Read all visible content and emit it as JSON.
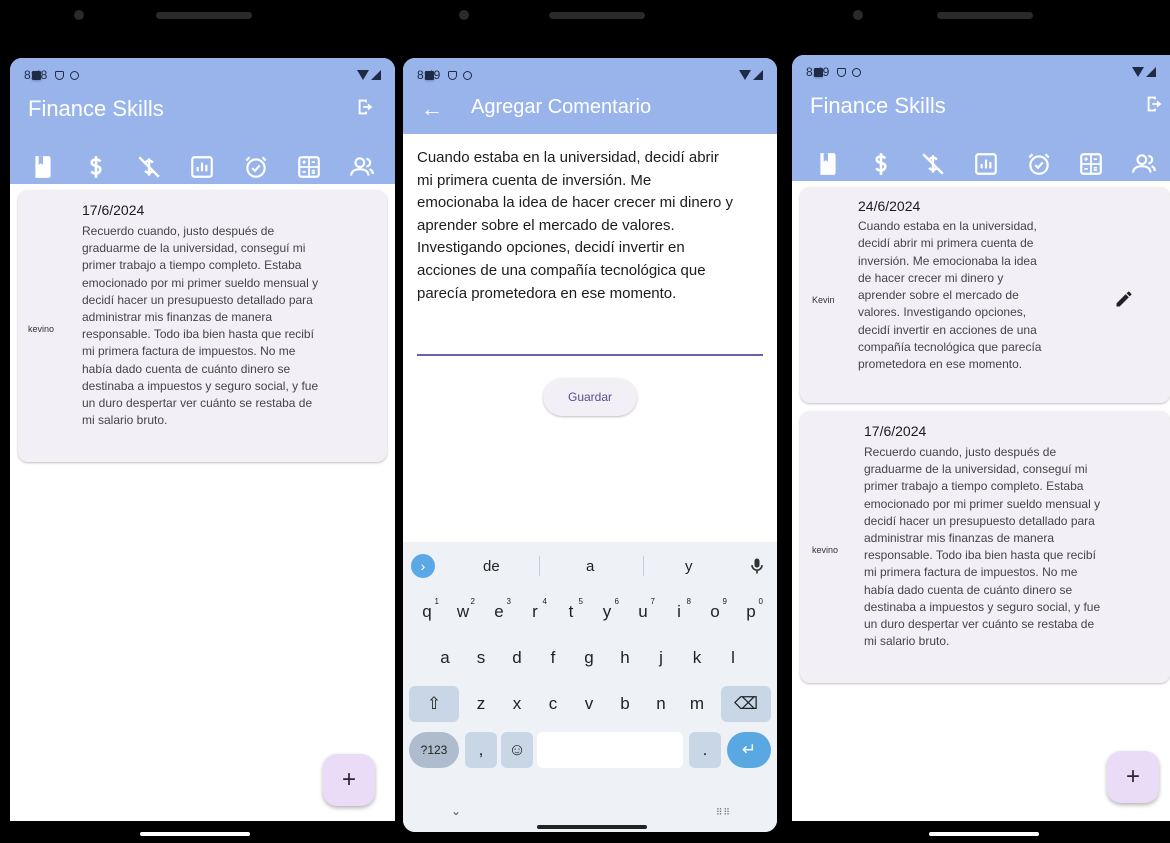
{
  "phone1": {
    "time": "8:48",
    "title": "Finance Skills",
    "comments": [
      {
        "author": "kevino",
        "date": "17/6/2024",
        "lines": [
          "Recuerdo cuando, justo después de",
          "graduarme de la universidad, conseguí mi",
          "primer trabajo a tiempo completo. Estaba",
          "emocionado por mi primer sueldo mensual y",
          "decidí hacer un presupuesto detallado para",
          "administrar mis finanzas de manera",
          "responsable. Todo iba bien hasta que recibí",
          "mi primera factura de impuestos. No me",
          "había dado cuenta de cuánto dinero se",
          "destinaba a impuestos y seguro social, y fue",
          "un duro despertar ver cuánto se restaba de",
          "mi salario bruto."
        ]
      }
    ],
    "fab_label": "+"
  },
  "phone2": {
    "time": "8:49",
    "title": "Agregar Comentario",
    "back_label": "←",
    "comment_lines": [
      "Cuando estaba en la universidad, decidí abrir",
      "mi primera cuenta de inversión. Me",
      "emocionaba la idea de hacer crecer mi dinero y",
      "aprender sobre el mercado de valores.",
      "Investigando opciones, decidí invertir en",
      "acciones de una compañía tecnológica que",
      "parecía prometedora en ese momento."
    ],
    "save_label": "Guardar",
    "keyboard": {
      "suggestions": [
        "de",
        "a",
        "y"
      ],
      "row1": [
        {
          "k": "q",
          "n": "1"
        },
        {
          "k": "w",
          "n": "2"
        },
        {
          "k": "e",
          "n": "3"
        },
        {
          "k": "r",
          "n": "4"
        },
        {
          "k": "t",
          "n": "5"
        },
        {
          "k": "y",
          "n": "6"
        },
        {
          "k": "u",
          "n": "7"
        },
        {
          "k": "i",
          "n": "8"
        },
        {
          "k": "o",
          "n": "9"
        },
        {
          "k": "p",
          "n": "0"
        }
      ],
      "row2": [
        "a",
        "s",
        "d",
        "f",
        "g",
        "h",
        "j",
        "k",
        "l"
      ],
      "row3": [
        "z",
        "x",
        "c",
        "v",
        "b",
        "n",
        "m"
      ],
      "symbols_label": "?123",
      "comma_label": ",",
      "period_label": ".",
      "emoji_label": "☺",
      "shift_label": "⇧",
      "backspace_label": "⌫",
      "enter_label": "↵",
      "hide_label": "⌄",
      "grid_label": "⠿⠿"
    }
  },
  "phone3": {
    "time": "8:49",
    "title": "Finance Skills",
    "comments": [
      {
        "author": "Kevin",
        "date": "24/6/2024",
        "lines": [
          "Cuando estaba en la universidad,",
          "decidí abrir mi primera cuenta de",
          "inversión. Me emocionaba la idea",
          "de hacer crecer mi dinero y",
          "aprender sobre el mercado de",
          "valores. Investigando opciones,",
          "decidí invertir en acciones de una",
          "compañía tecnológica que parecía",
          "prometedora en ese momento."
        ]
      },
      {
        "author": "kevino",
        "date": "17/6/2024",
        "lines": [
          "Recuerdo cuando, justo después de",
          "graduarme de la universidad, conseguí mi",
          "primer trabajo a tiempo completo. Estaba",
          "emocionado por mi primer sueldo mensual y",
          "decidí hacer un presupuesto detallado para",
          "administrar mis finanzas de manera",
          "responsable. Todo iba bien hasta que recibí",
          "mi primera factura de impuestos. No me",
          "había dado cuenta de cuánto dinero se",
          "destinaba a impuestos y seguro social, y fue",
          "un duro despertar ver cuánto se restaba de",
          "mi salario bruto."
        ]
      }
    ],
    "fab_label": "+"
  },
  "tabs": [
    {
      "icon": "book-icon"
    },
    {
      "icon": "dollar-icon"
    },
    {
      "icon": "no-money-icon"
    },
    {
      "icon": "chart-icon"
    },
    {
      "icon": "alarm-icon"
    },
    {
      "icon": "calculator-icon"
    },
    {
      "icon": "community-icon"
    }
  ],
  "colors": {
    "appbar": "#98b4ea",
    "card": "#f3eff6",
    "fab": "#eadcf7",
    "accent": "#5b4c8f",
    "keyboard": "#eef1f6",
    "enter_key": "#59a8e2"
  }
}
